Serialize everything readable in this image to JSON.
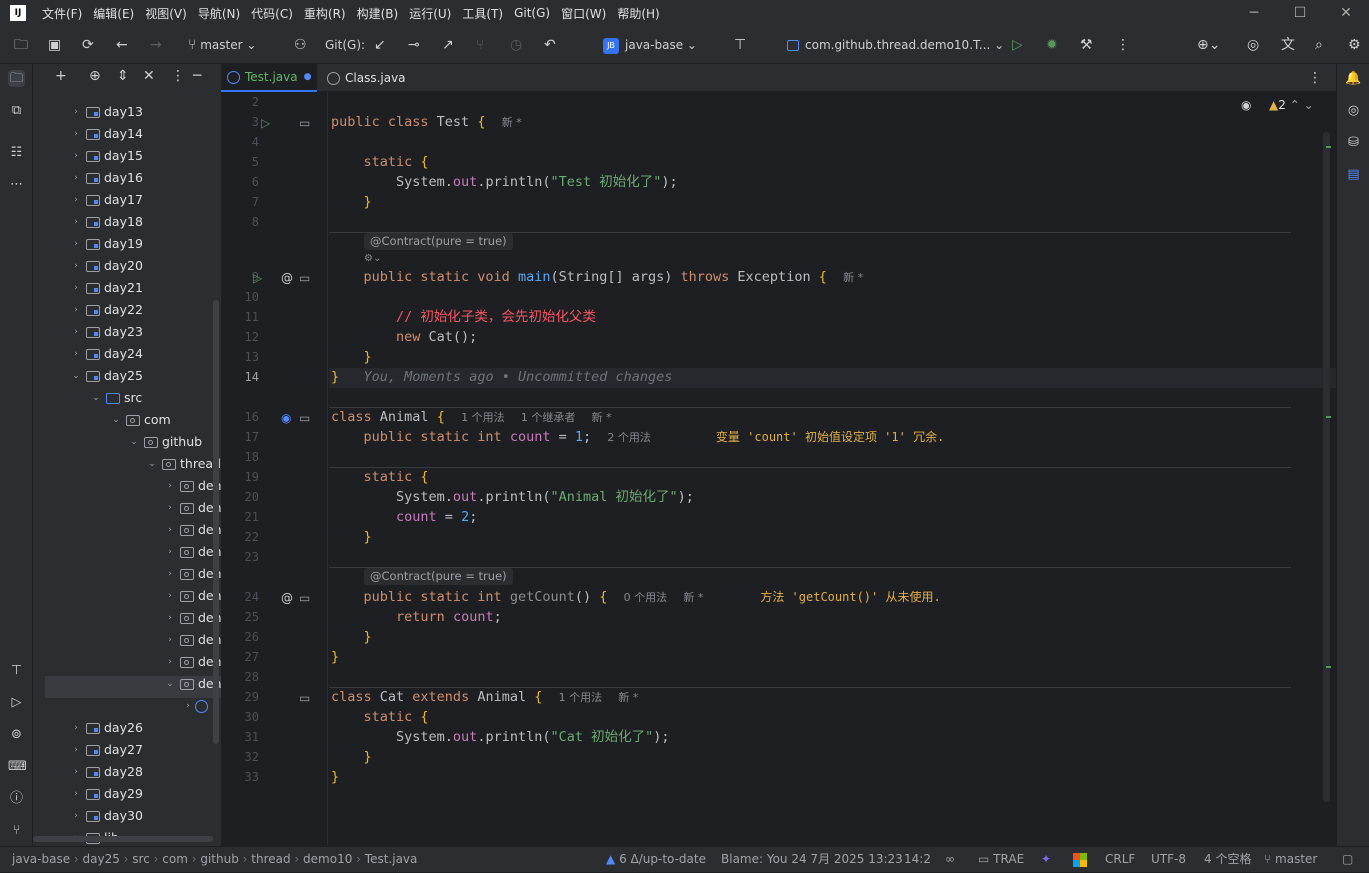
{
  "menu": [
    "文件(F)",
    "编辑(E)",
    "视图(V)",
    "导航(N)",
    "代码(C)",
    "重构(R)",
    "构建(B)",
    "运行(U)",
    "工具(T)",
    "Git(G)",
    "窗口(W)",
    "帮助(H)"
  ],
  "toolbar": {
    "branch": "master",
    "git_label": "Git(G):",
    "project": "java-base",
    "project_badge": "JB",
    "run_config": "com.github.thread.demo10.T..."
  },
  "project_tree": [
    {
      "label": "day13"
    },
    {
      "label": "day14"
    },
    {
      "label": "day15"
    },
    {
      "label": "day16"
    },
    {
      "label": "day17"
    },
    {
      "label": "day18"
    },
    {
      "label": "day19"
    },
    {
      "label": "day20"
    },
    {
      "label": "day21"
    },
    {
      "label": "day22"
    },
    {
      "label": "day23"
    },
    {
      "label": "day24"
    },
    {
      "label": "day25"
    },
    {
      "label": "src"
    },
    {
      "label": "com"
    },
    {
      "label": "github"
    },
    {
      "label": "thread"
    },
    {
      "label": "den"
    },
    {
      "label": "den"
    },
    {
      "label": "den"
    },
    {
      "label": "den"
    },
    {
      "label": "den"
    },
    {
      "label": "den"
    },
    {
      "label": "den"
    },
    {
      "label": "den"
    },
    {
      "label": "den"
    },
    {
      "label": "den"
    },
    {
      "label": "day26"
    },
    {
      "label": "day27"
    },
    {
      "label": "day28"
    },
    {
      "label": "day29"
    },
    {
      "label": "day30"
    },
    {
      "label": "lib"
    }
  ],
  "tabs": [
    {
      "label": "Test.java"
    },
    {
      "label": "Class.java"
    }
  ],
  "inspections": {
    "warnings": "2"
  },
  "code": {
    "line_numbers": [
      "2",
      "3",
      "4",
      "5",
      "6",
      "7",
      "8",
      "9",
      "10",
      "11",
      "12",
      "13",
      "14",
      "16",
      "17",
      "18",
      "19",
      "20",
      "21",
      "22",
      "23",
      "24",
      "25",
      "26",
      "27",
      "28",
      "29",
      "30",
      "31",
      "32",
      "33"
    ],
    "blame": "You, Moments ago • Uncommitted changes",
    "contract": "@Contract(pure = true)",
    "new_star": "新 *",
    "usages_1": "1 个用法",
    "inheritors_1": "1 个继承者",
    "usages_2": "2 个用法",
    "usages_0": "0 个用法",
    "warn_count": "变量 'count' 初始值设定项 '1' 冗余.",
    "warn_getcount": "方法 'getCount()' 从未使用."
  },
  "status": {
    "breadcrumb": [
      "java-base",
      "day25",
      "src",
      "com",
      "github",
      "thread",
      "demo10",
      "Test.java"
    ],
    "vcs": "6 Δ/up-to-date",
    "blame": "Blame: You 24 7月 2025 13:23",
    "position": "14:2",
    "trae": "TRAE",
    "line_sep": "CRLF",
    "encoding": "UTF-8",
    "indent": "4 个空格",
    "branch": "master"
  }
}
